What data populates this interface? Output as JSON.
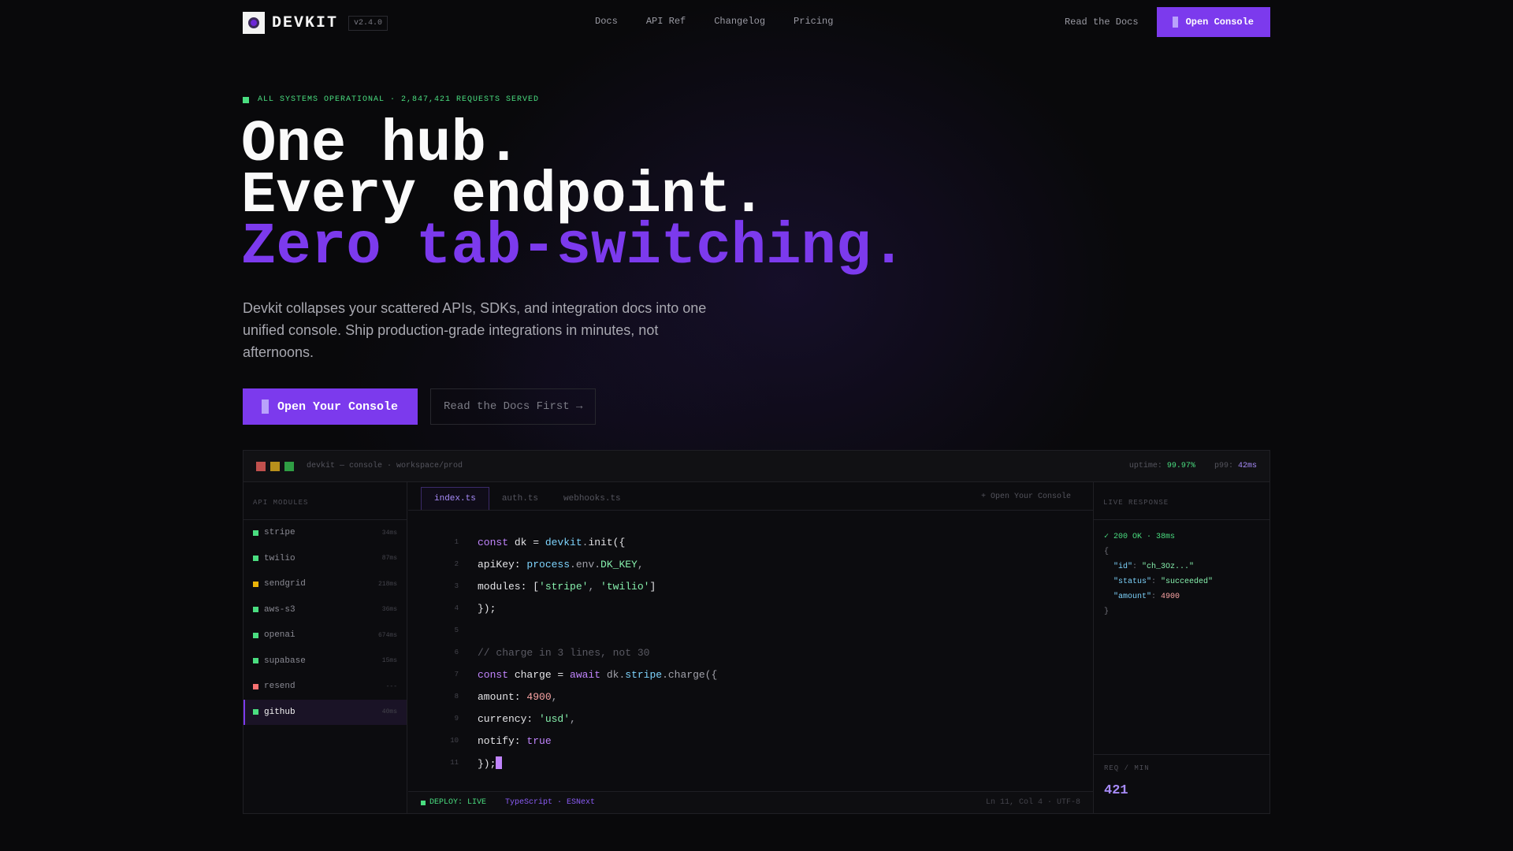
{
  "brand": {
    "name": "DEVKIT",
    "version": "v2.4.0"
  },
  "nav": {
    "links": [
      "Docs",
      "API Ref",
      "Changelog",
      "Pricing"
    ],
    "read_docs": "Read the Docs",
    "open_console": "Open Console"
  },
  "hero": {
    "status": "ALL SYSTEMS OPERATIONAL · 2,847,421 REQUESTS SERVED",
    "headline": [
      "One hub.",
      "Every endpoint.",
      "Zero tab-switching."
    ],
    "lede": "Devkit collapses your scattered APIs, SDKs, and integration docs into one unified console. Ship production-grade integrations in minutes, not afternoons.",
    "cta_primary": "Open Your Console",
    "cta_secondary": "Read the Docs First →"
  },
  "console": {
    "path": "devkit — console · workspace/prod",
    "metrics": {
      "uptime_label": "uptime:",
      "uptime": "99.97%",
      "p99_label": "p99:",
      "p99": "42ms"
    },
    "sidebar_title": "API MODULES",
    "modules": [
      {
        "name": "stripe",
        "ms": "34ms",
        "status": "#4ade80"
      },
      {
        "name": "twilio",
        "ms": "87ms",
        "status": "#4ade80"
      },
      {
        "name": "sendgrid",
        "ms": "218ms",
        "status": "#eab308"
      },
      {
        "name": "aws-s3",
        "ms": "36ms",
        "status": "#4ade80"
      },
      {
        "name": "openai",
        "ms": "674ms",
        "status": "#4ade80"
      },
      {
        "name": "supabase",
        "ms": "15ms",
        "status": "#4ade80"
      },
      {
        "name": "resend",
        "ms": "---",
        "status": "#f87171"
      },
      {
        "name": "github",
        "ms": "40ms",
        "status": "#4ade80",
        "active": true
      }
    ],
    "tabs": [
      "index.ts",
      "auth.ts",
      "webhooks.ts"
    ],
    "tab_open": "+ Open Your Console",
    "line_numbers": [
      "1",
      "2",
      "3",
      "4",
      "5",
      "6",
      "7",
      "8",
      "9",
      "10",
      "11"
    ],
    "statusbar": {
      "deploy": "DEPLOY: LIVE",
      "lang": "TypeScript · ESNext",
      "pos": "Ln 11, Col 4 · UTF-8"
    },
    "response": {
      "title": "LIVE RESPONSE",
      "status": "✓ 200 OK · 38ms",
      "open": "{",
      "fields": [
        {
          "key": "\"id\"",
          "value": "\"ch_3Oz...\"",
          "kind": "string"
        },
        {
          "key": "\"status\"",
          "value": "\"succeeded\"",
          "kind": "string"
        },
        {
          "key": "\"amount\"",
          "value": "4900",
          "kind": "number"
        }
      ],
      "close": "}",
      "rpm_label": "REQ / MIN",
      "rpm_value": "421"
    }
  },
  "colors": {
    "accent": "#7c3aed",
    "ok": "#4ade80",
    "warn": "#eab308",
    "error": "#f87171"
  }
}
